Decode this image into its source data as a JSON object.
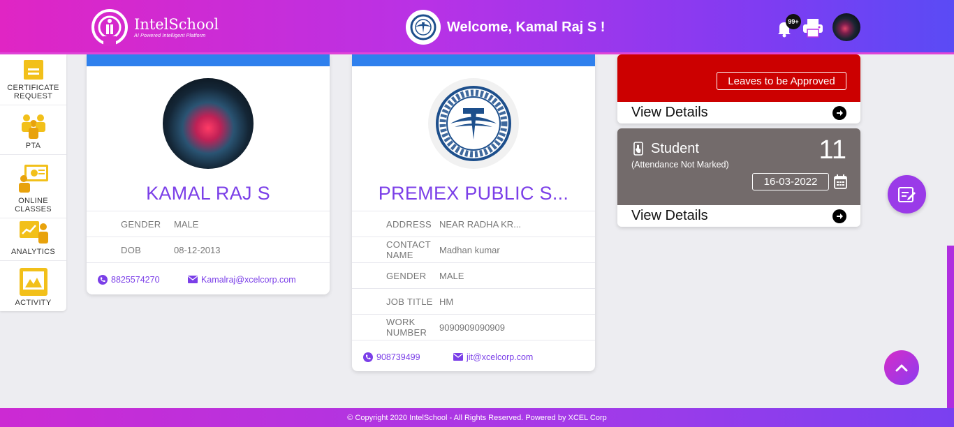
{
  "header": {
    "logo_name": "IntelSchool",
    "logo_tagline": "AI Powered Intelligent Platform",
    "welcome": "Welcome, Kamal Raj S !",
    "notification_badge": "99+",
    "icons": [
      "bell-icon",
      "printer-icon",
      "avatar"
    ]
  },
  "sidebar": {
    "items": [
      {
        "label": "CERTIFICATE REQUEST",
        "icon": "certificate-icon"
      },
      {
        "label": "PTA",
        "icon": "people-icon"
      },
      {
        "label": "ONLINE CLASSES",
        "icon": "online-class-icon"
      },
      {
        "label": "ANALYTICS",
        "icon": "analytics-icon"
      },
      {
        "label": "ACTIVITY",
        "icon": "activity-icon"
      }
    ]
  },
  "profile": {
    "name": "KAMAL RAJ S",
    "fields": [
      {
        "key": "GENDER",
        "value": "MALE"
      },
      {
        "key": "DOB",
        "value": "08-12-2013"
      }
    ],
    "phone": "8825574270",
    "email": "Kamalraj@xcelcorp.com"
  },
  "school": {
    "name": "PREMEX PUBLIC S...",
    "fields": [
      {
        "key": "ADDRESS",
        "value": "NEAR RADHA KR..."
      },
      {
        "key": "CONTACT NAME",
        "value": "Madhan kumar"
      },
      {
        "key": "GENDER",
        "value": "MALE"
      },
      {
        "key": "JOB TITLE",
        "value": "HM"
      },
      {
        "key": "WORK NUMBER",
        "value": "9090909090909"
      }
    ],
    "phone": "908739499",
    "email": "jit@xcelcorp.com"
  },
  "leaves_panel": {
    "button": "Leaves to be Approved",
    "view_details": "View Details",
    "color": "#cc0000"
  },
  "attendance_panel": {
    "title": "Student",
    "subtitle": "(Attendance Not Marked)",
    "count": "11",
    "date": "16-03-2022",
    "view_details": "View Details",
    "color": "#736b6b"
  },
  "footer": {
    "text": "© Copyright 2020 IntelSchool - All Rights Reserved. Powered by XCEL Corp"
  },
  "colors": {
    "accent": "#7b3fe8",
    "card_top": "#2f80ed",
    "header_start": "#e025c4",
    "header_end": "#5a4bf5"
  }
}
